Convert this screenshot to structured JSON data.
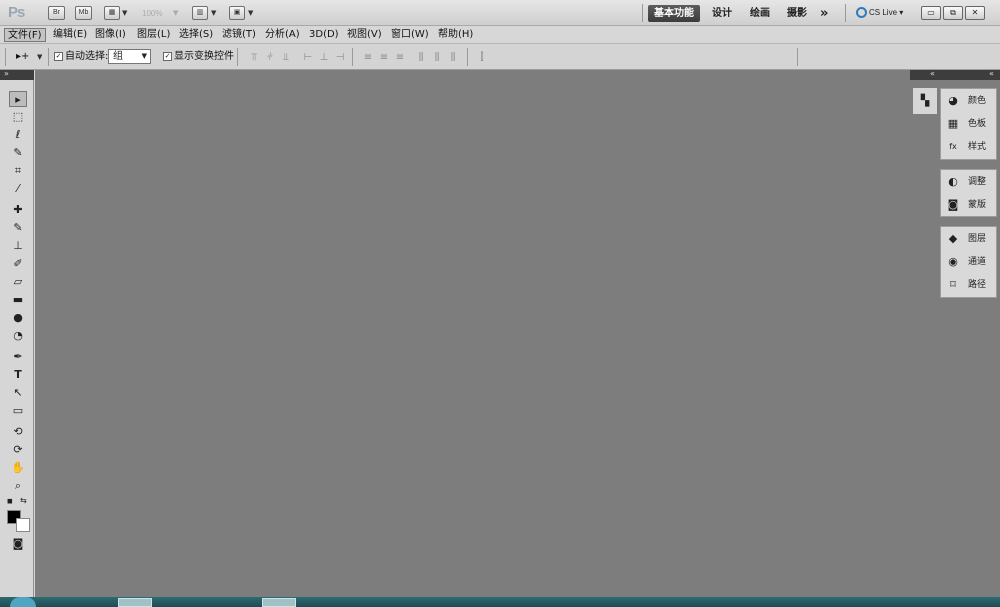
{
  "app": {
    "logo": "Ps",
    "bridge_label": "Br",
    "minibridge_label": "Mb",
    "zoom": "100%",
    "workspaces": [
      "基本功能",
      "设计",
      "绘画",
      "摄影"
    ],
    "active_workspace": "基本功能",
    "more_label": "»",
    "cslive_label": "CS Live ▾",
    "window_controls": [
      "▭",
      "⧉",
      "✕"
    ]
  },
  "menu": {
    "items": [
      "文件(F)",
      "编辑(E)",
      "图像(I)",
      "图层(L)",
      "选择(S)",
      "滤镜(T)",
      "分析(A)",
      "3D(D)",
      "视图(V)",
      "窗口(W)",
      "帮助(H)"
    ],
    "active_index": 0
  },
  "options": {
    "tool_preset": "▸+",
    "auto_select_label": "自动选择:",
    "auto_select_checked": true,
    "auto_select_value": "组",
    "show_transform_label": "显示变换控件",
    "show_transform_checked": true
  },
  "toolbox": {
    "tools": [
      {
        "icon": "move-tool-icon",
        "glyph": "▸"
      },
      {
        "icon": "marquee-tool-icon",
        "glyph": "⬚"
      },
      {
        "icon": "lasso-tool-icon",
        "glyph": "ℓ"
      },
      {
        "icon": "quick-select-tool-icon",
        "glyph": "✎"
      },
      {
        "icon": "crop-tool-icon",
        "glyph": "⌗"
      },
      {
        "icon": "eyedropper-tool-icon",
        "glyph": "⁄"
      },
      {
        "icon": "healing-brush-tool-icon",
        "glyph": "✚"
      },
      {
        "icon": "brush-tool-icon",
        "glyph": "✎"
      },
      {
        "icon": "clone-stamp-tool-icon",
        "glyph": "⊥"
      },
      {
        "icon": "history-brush-tool-icon",
        "glyph": "✐"
      },
      {
        "icon": "eraser-tool-icon",
        "glyph": "▱"
      },
      {
        "icon": "gradient-tool-icon",
        "glyph": "▬"
      },
      {
        "icon": "blur-tool-icon",
        "glyph": "●"
      },
      {
        "icon": "dodge-tool-icon",
        "glyph": "◔"
      },
      {
        "icon": "pen-tool-icon",
        "glyph": "✒"
      },
      {
        "icon": "type-tool-icon",
        "glyph": "T"
      },
      {
        "icon": "path-select-tool-icon",
        "glyph": "↖"
      },
      {
        "icon": "shape-tool-icon",
        "glyph": "▭"
      },
      {
        "icon": "3d-rotate-tool-icon",
        "glyph": "⟲"
      },
      {
        "icon": "3d-orbit-tool-icon",
        "glyph": "⟳"
      },
      {
        "icon": "hand-tool-icon",
        "glyph": "✋"
      },
      {
        "icon": "zoom-tool-icon",
        "glyph": "⌕"
      }
    ]
  },
  "panels": {
    "groups": [
      [
        {
          "label": "颜色",
          "icon": "color-icon",
          "glyph": "◕"
        },
        {
          "label": "色板",
          "icon": "swatches-icon",
          "glyph": "▦"
        },
        {
          "label": "样式",
          "icon": "styles-icon",
          "glyph": "fx"
        }
      ],
      [
        {
          "label": "调整",
          "icon": "adjustments-icon",
          "glyph": "◐"
        },
        {
          "label": "蒙版",
          "icon": "masks-icon",
          "glyph": "◙"
        }
      ],
      [
        {
          "label": "图层",
          "icon": "layers-icon",
          "glyph": "◆"
        },
        {
          "label": "通道",
          "icon": "channels-icon",
          "glyph": "◉"
        },
        {
          "label": "路径",
          "icon": "paths-icon",
          "glyph": "⌑"
        }
      ]
    ]
  },
  "colors": {
    "canvas": "#7d7d7d",
    "active_workspace_bg": "#4a4a4a",
    "taskbar": "#1f4b53"
  }
}
